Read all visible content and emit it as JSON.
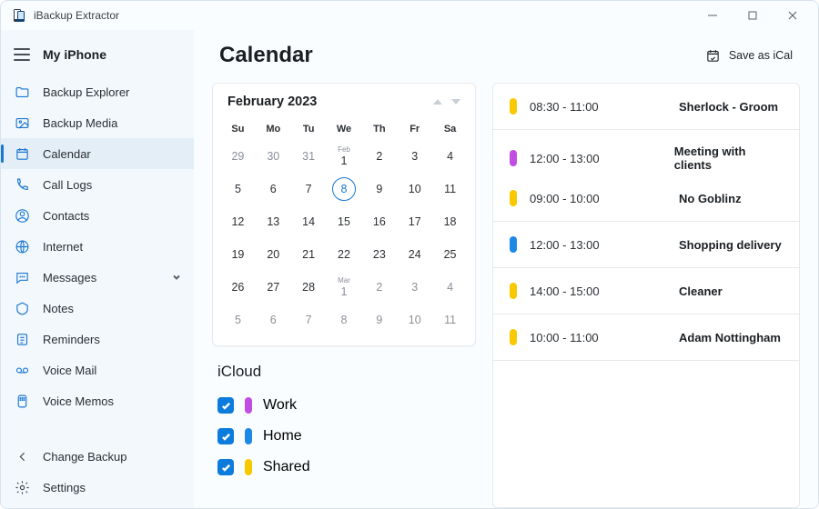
{
  "app": {
    "title": "iBackup Extractor"
  },
  "sidebar": {
    "device_label": "My iPhone",
    "items": [
      {
        "label": "Backup Explorer",
        "icon": "folder"
      },
      {
        "label": "Backup Media",
        "icon": "image"
      },
      {
        "label": "Calendar",
        "icon": "calendar",
        "active": true
      },
      {
        "label": "Call Logs",
        "icon": "phone"
      },
      {
        "label": "Contacts",
        "icon": "user"
      },
      {
        "label": "Internet",
        "icon": "globe"
      },
      {
        "label": "Messages",
        "icon": "message",
        "chevron": true
      },
      {
        "label": "Notes",
        "icon": "note"
      },
      {
        "label": "Reminders",
        "icon": "reminder"
      },
      {
        "label": "Voice Mail",
        "icon": "voicemail"
      },
      {
        "label": "Voice Memos",
        "icon": "mic"
      }
    ],
    "bottom": [
      {
        "label": "Change Backup",
        "icon": "back"
      },
      {
        "label": "Settings",
        "icon": "gear"
      }
    ]
  },
  "main": {
    "title": "Calendar",
    "save_label": "Save as iCal"
  },
  "calendar": {
    "month_label": "February 2023",
    "dow": [
      "Su",
      "Mo",
      "Tu",
      "We",
      "Th",
      "Fr",
      "Sa"
    ],
    "days": [
      {
        "n": "29",
        "other": true
      },
      {
        "n": "30",
        "other": true
      },
      {
        "n": "31",
        "other": true
      },
      {
        "n": "1",
        "mlabel": "Feb"
      },
      {
        "n": "2"
      },
      {
        "n": "3"
      },
      {
        "n": "4"
      },
      {
        "n": "5"
      },
      {
        "n": "6"
      },
      {
        "n": "7"
      },
      {
        "n": "8",
        "selected": true
      },
      {
        "n": "9"
      },
      {
        "n": "10"
      },
      {
        "n": "11"
      },
      {
        "n": "12"
      },
      {
        "n": "13"
      },
      {
        "n": "14"
      },
      {
        "n": "15"
      },
      {
        "n": "16"
      },
      {
        "n": "17"
      },
      {
        "n": "18"
      },
      {
        "n": "19"
      },
      {
        "n": "20"
      },
      {
        "n": "21"
      },
      {
        "n": "22"
      },
      {
        "n": "23"
      },
      {
        "n": "24"
      },
      {
        "n": "25"
      },
      {
        "n": "26"
      },
      {
        "n": "27"
      },
      {
        "n": "28"
      },
      {
        "n": "1",
        "mlabel": "Mar",
        "other": true
      },
      {
        "n": "2",
        "other": true
      },
      {
        "n": "3",
        "other": true
      },
      {
        "n": "4",
        "other": true
      },
      {
        "n": "5",
        "other": true
      },
      {
        "n": "6",
        "other": true
      },
      {
        "n": "7",
        "other": true
      },
      {
        "n": "8",
        "other": true
      },
      {
        "n": "9",
        "other": true
      },
      {
        "n": "10",
        "other": true
      },
      {
        "n": "11",
        "other": true
      }
    ]
  },
  "iCloud": {
    "title": "iCloud",
    "calendars": [
      {
        "name": "Work",
        "color": "purple",
        "checked": true
      },
      {
        "name": "Home",
        "color": "blue",
        "checked": true
      },
      {
        "name": "Shared",
        "color": "yellow",
        "checked": true
      }
    ]
  },
  "colors": {
    "yellow": "#f9c900",
    "purple": "#c24de2",
    "blue": "#1e88e5"
  },
  "events": [
    {
      "group": 0,
      "color": "yellow",
      "time": "08:30 - 11:00",
      "title": "Sherlock - Groom"
    },
    {
      "group": 1,
      "color": "purple",
      "time": "12:00 - 13:00",
      "title": "Meeting with clients"
    },
    {
      "group": 1,
      "color": "yellow",
      "time": "09:00 - 10:00",
      "title": "No Goblinz"
    },
    {
      "group": 2,
      "color": "blue",
      "time": "12:00 - 13:00",
      "title": "Shopping delivery"
    },
    {
      "group": 3,
      "color": "yellow",
      "time": "14:00 - 15:00",
      "title": "Cleaner"
    },
    {
      "group": 4,
      "color": "yellow",
      "time": "10:00 - 11:00",
      "title": "Adam Nottingham"
    }
  ]
}
